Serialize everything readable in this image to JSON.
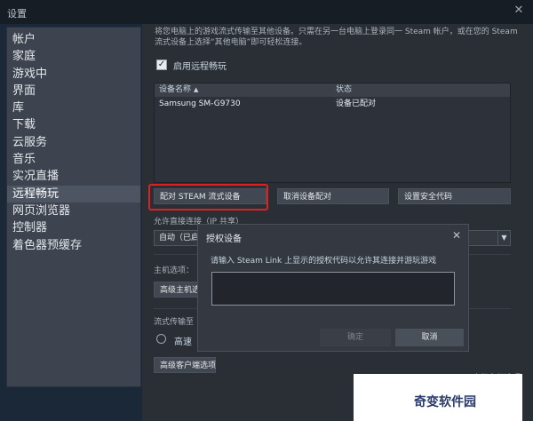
{
  "window": {
    "title": "设置",
    "close_icon": "close-icon"
  },
  "sidebar": {
    "items": [
      {
        "label": "帐户"
      },
      {
        "label": "家庭"
      },
      {
        "label": "游戏中"
      },
      {
        "label": "界面"
      },
      {
        "label": "库"
      },
      {
        "label": "下载"
      },
      {
        "label": "云服务"
      },
      {
        "label": "音乐"
      },
      {
        "label": "实况直播"
      },
      {
        "label": "远程畅玩",
        "active": true
      },
      {
        "label": "网页浏览器"
      },
      {
        "label": "控制器"
      },
      {
        "label": "着色器预缓存"
      }
    ]
  },
  "main": {
    "description": "将您电脑上的游戏流式传输至其他设备。只需在另一台电脑上登录同一 Steam 帐户，或在您的 Steam 流式设备上选择“其他电脑”即可轻松连接。",
    "enable_checkbox": {
      "label": "启用远程畅玩",
      "checked": true
    },
    "devices_table": {
      "columns": [
        "设备名称",
        "状态"
      ],
      "rows": [
        {
          "name": "Samsung SM-G9730",
          "status": "设备已配对"
        }
      ]
    },
    "buttons": {
      "pair": "配对 STEAM 流式设备",
      "unpair": "取消设备配对",
      "security_code": "设置安全代码",
      "advanced_host": "高级主机选",
      "advanced_client": "高级客户端选项"
    },
    "allow_direct_label": "允许直接连接（IP 共享）",
    "direct_select_value": "自动（已启",
    "host_options_label": "主机选项：",
    "streaming_label": "流式传输至",
    "radio_label": "高速",
    "bottom_cut_text": "高级主机选项"
  },
  "dialog": {
    "title": "授权设备",
    "message": "请输入 Steam Link 上显示的授权代码以允许其连接并游玩游戏",
    "input_value": "",
    "confirm": "确定",
    "cancel": "取消"
  },
  "watermark": {
    "text": "奇变软件园"
  }
}
